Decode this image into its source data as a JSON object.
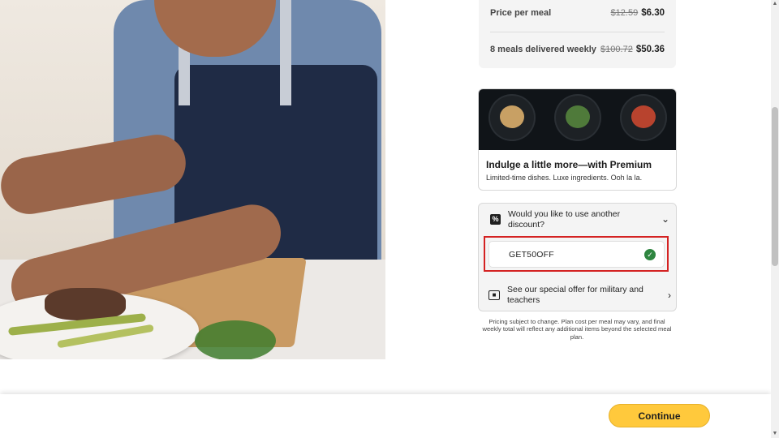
{
  "pricing": {
    "per_meal_label": "Price per meal",
    "per_meal_old": "$12.59",
    "per_meal_new": "$6.30",
    "weekly_label": "8 meals delivered weekly",
    "weekly_old": "$100.72",
    "weekly_new": "$50.36"
  },
  "premium": {
    "title": "Indulge a little more—with Premium",
    "subtitle": "Limited-time dishes. Luxe ingredients. Ooh la la."
  },
  "discount": {
    "question": "Would you like to use another discount?",
    "code_value": "GET50OFF",
    "military_offer": "See our special offer for military and teachers"
  },
  "fine_print": "Pricing subject to change. Plan cost per meal may vary, and final weekly total will reflect any additional items beyond the selected meal plan.",
  "continue_label": "Continue",
  "colors": {
    "accent": "#ffc93c",
    "success": "#2e8540",
    "highlight": "#d42222"
  },
  "icons": [
    "percent-icon",
    "chevron-down-icon",
    "check-circle-icon",
    "id-card-icon",
    "chevron-right-icon"
  ]
}
